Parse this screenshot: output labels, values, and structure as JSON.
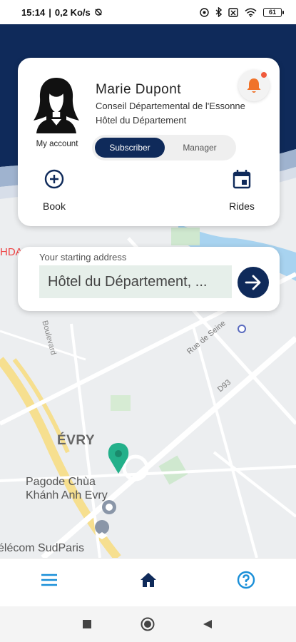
{
  "status_bar": {
    "time": "15:14",
    "network_speed": "0,2 Ko/s",
    "battery": "61",
    "icons": [
      "nfc-icon",
      "bluetooth-icon",
      "sim-icon",
      "wifi-icon",
      "battery-icon"
    ]
  },
  "profile": {
    "avatar": "avatar-woman-icon",
    "my_account_label": "My account",
    "name": "Marie  Dupont",
    "organization": "Conseil Départemental de l'Essonne",
    "site": "Hôtel du Département",
    "bell": "bell-icon"
  },
  "role_toggle": {
    "subscriber_label": "Subscriber",
    "manager_label": "Manager",
    "selected": "Subscriber"
  },
  "actions": {
    "book_label": "Book",
    "rides_label": "Rides"
  },
  "address": {
    "label": "Your starting address",
    "value": "Hôtel du Département, ..."
  },
  "map": {
    "labels": {
      "hda": "HDA",
      "evry": "ÉVRY",
      "pagode_line1": "Pagode Chùa",
      "pagode_line2": "Khánh Anh Evry",
      "telecom": "élécom SudParis",
      "seine": "Rue de Seine",
      "d93": "D93",
      "street": "Boulevard"
    }
  },
  "bottom_nav": {
    "items": [
      "menu-icon",
      "home-icon",
      "help-icon"
    ]
  },
  "colors": {
    "primary": "#0f2a5a",
    "accent": "#1a8fd8",
    "bell": "#f0732a",
    "marker": "#23b08a"
  }
}
